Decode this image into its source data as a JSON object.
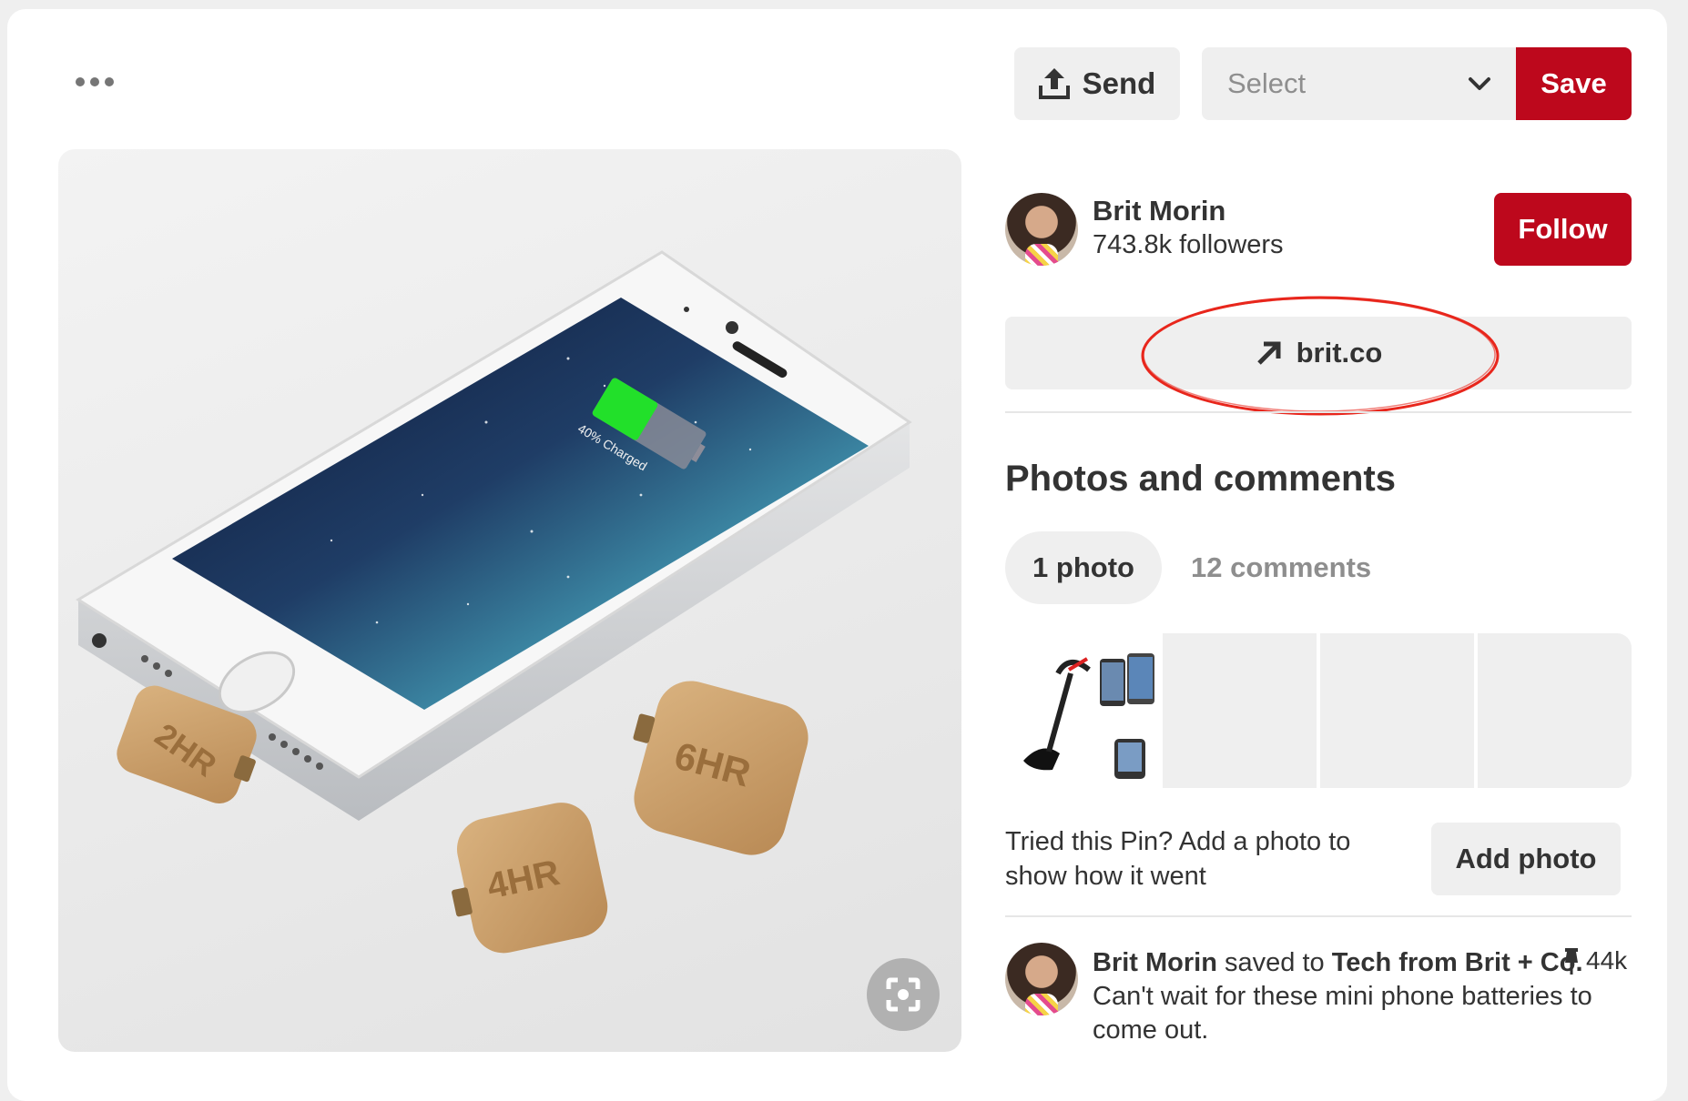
{
  "toolbar": {
    "more_icon": "more-horizontal-icon",
    "send_label": "Send",
    "send_icon": "share-upload-icon",
    "board_select_value": "Select",
    "save_label": "Save"
  },
  "creator": {
    "name": "Brit Morin",
    "followers": "743.8k followers",
    "follow_label": "Follow"
  },
  "source_link": {
    "label": "brit.co",
    "icon": "arrow-up-right-icon"
  },
  "image_labels": {
    "charge_text": "40% Charged",
    "battery_2": "2HR",
    "battery_4": "4HR",
    "battery_6": "6HR"
  },
  "photos_section": {
    "title": "Photos and comments",
    "tabs": [
      {
        "label": "1 photo",
        "active": true
      },
      {
        "label": "12 comments",
        "active": false
      }
    ],
    "prompt": "Tried this Pin? Add a photo to show how it went",
    "add_photo_label": "Add photo"
  },
  "activity": {
    "user": "Brit Morin",
    "verb": "saved to",
    "board": "Tech from Brit + Co.",
    "description": "Can't wait for these mini phone batteries to come out.",
    "saves_count": "44k",
    "saves_icon": "pin-icon"
  },
  "colors": {
    "brand_red": "#bd081c",
    "button_gray": "#efefef",
    "annotation_red": "#e8261c",
    "battery_green": "#22e02a"
  }
}
